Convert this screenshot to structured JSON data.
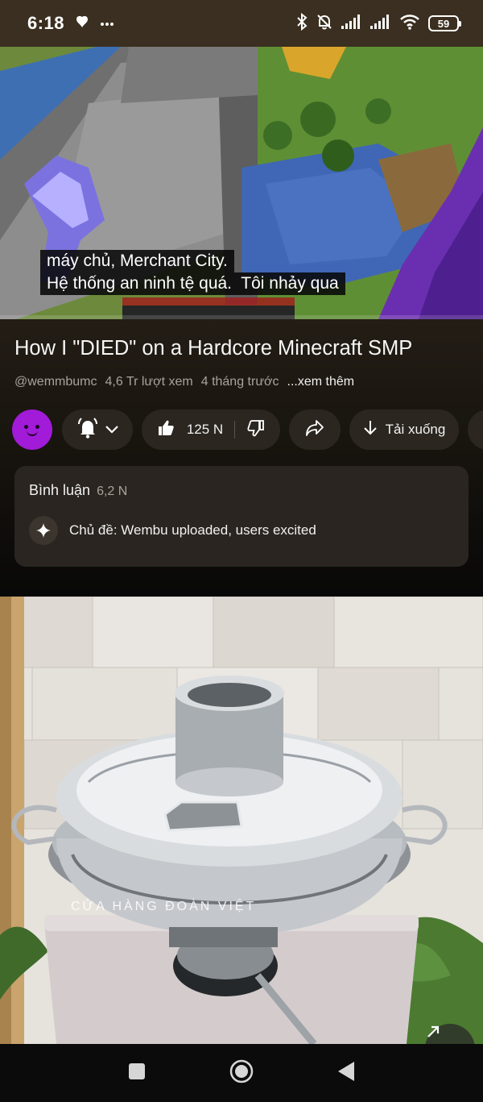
{
  "status_bar": {
    "time": "6:18",
    "battery": "59",
    "icons": [
      "notification-icon",
      "more-icon",
      "bluetooth-icon",
      "mute-icon",
      "signal-icon",
      "signal-icon",
      "wifi-icon",
      "battery-icon"
    ]
  },
  "video": {
    "captions": [
      "máy chủ, Merchant City.",
      "Hệ thống an ninh tệ quá.  Tôi nhảy qua"
    ]
  },
  "details": {
    "title": "How I \"DIED\" on a Hardcore Minecraft SMP",
    "channel_handle": "@wemmbumc",
    "views": "4,6 Tr lượt xem",
    "age": "4 tháng trước",
    "more": "...xem thêm"
  },
  "actions": {
    "subscribe_icon": "bell-icon",
    "likes": "125 N",
    "download_label": "Tải xuống"
  },
  "comments": {
    "label": "Bình luận",
    "count": "6,2 N",
    "topic": "Chủ đề: Wembu uploaded, users excited"
  },
  "next_video": {
    "watermark": "CỬA HÀNG ĐOÀN VIỆT"
  },
  "colors": {
    "background": "#0f0f0f",
    "avatar": "#a21bd8",
    "pill": "#2b2620",
    "card": "#2a2520"
  }
}
